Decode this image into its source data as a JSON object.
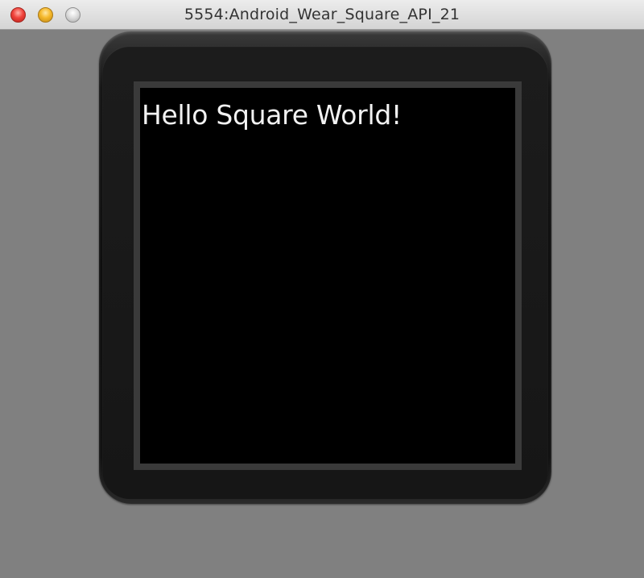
{
  "window": {
    "title": "5554:Android_Wear_Square_API_21",
    "controls": {
      "close_icon": "red-close-circle",
      "minimize_icon": "yellow-minimize-circle",
      "zoom_icon": "gray-zoom-circle"
    }
  },
  "watch": {
    "screen_text": "Hello Square World!"
  },
  "colors": {
    "background": "#808080",
    "screen": "#000000",
    "text": "#f2f2f2"
  }
}
